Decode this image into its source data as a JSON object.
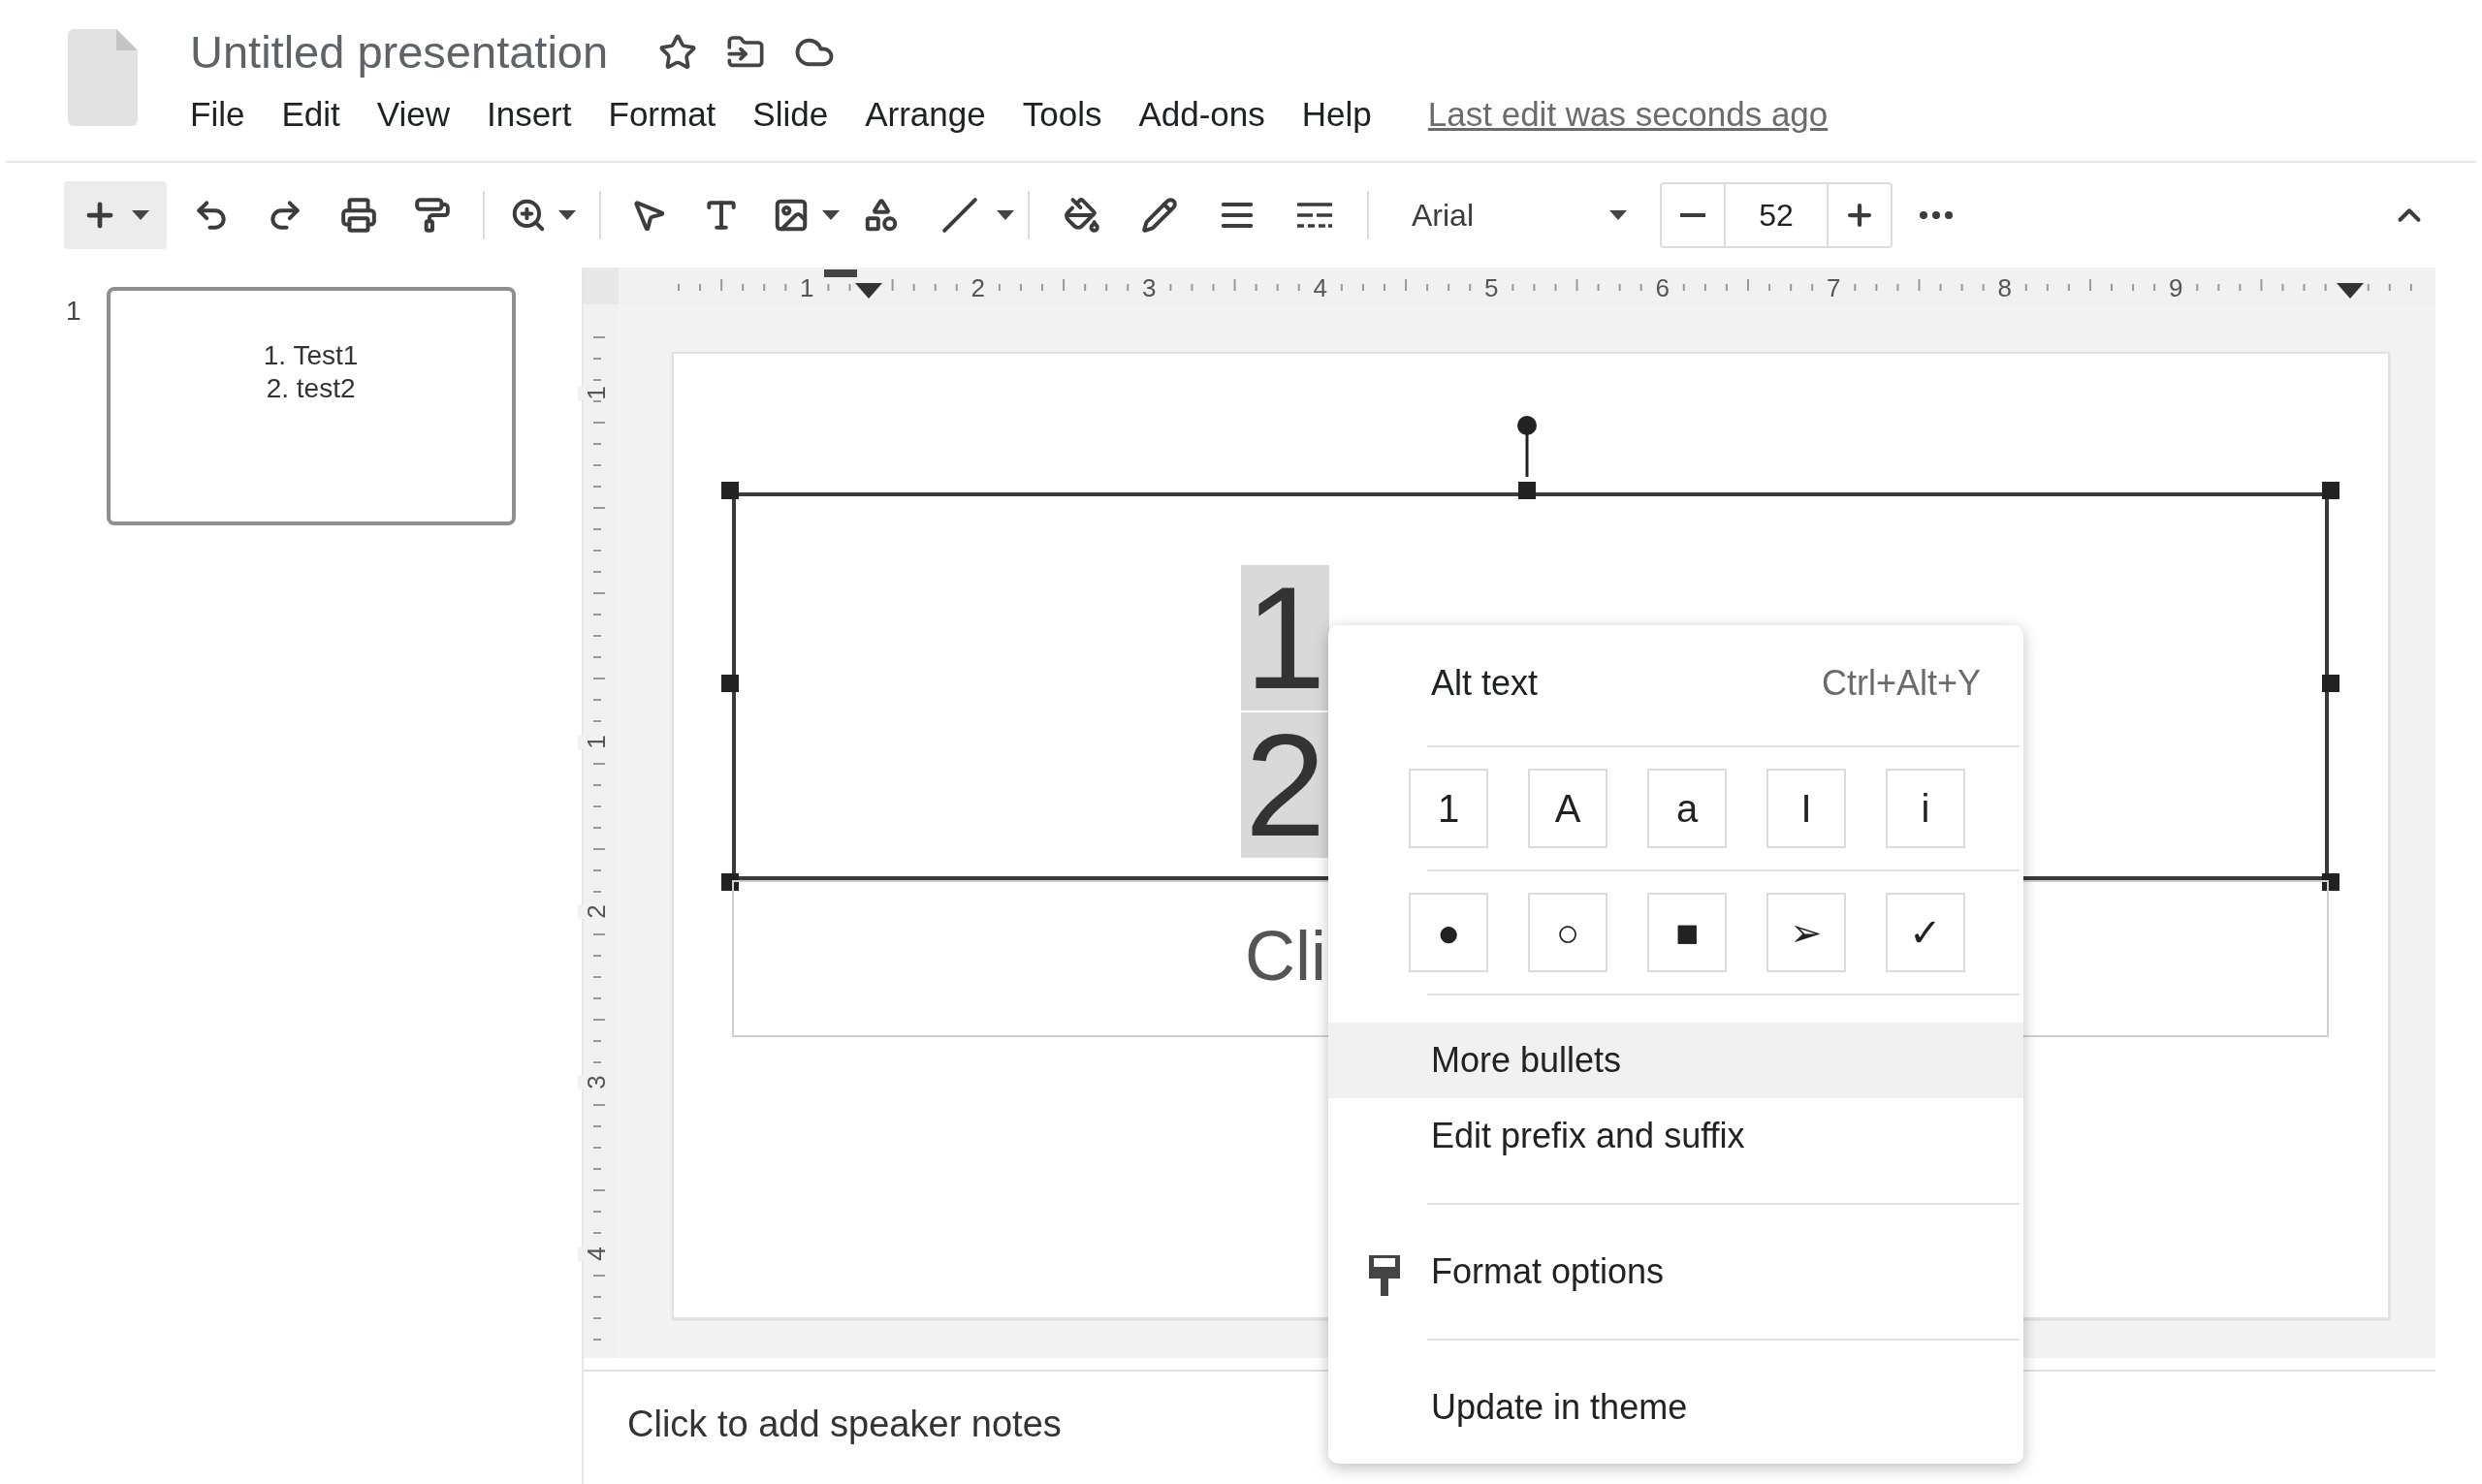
{
  "document": {
    "title": "Untitled presentation",
    "last_edit": "Last edit was seconds ago"
  },
  "menu_bar": [
    "File",
    "Edit",
    "View",
    "Insert",
    "Format",
    "Slide",
    "Arrange",
    "Tools",
    "Add-ons",
    "Help"
  ],
  "toolbar": {
    "font": "Arial",
    "font_size": "52"
  },
  "filmstrip": [
    {
      "number": "1",
      "selected": true,
      "lines": [
        "1. Test1",
        "2. test2"
      ]
    }
  ],
  "ruler": {
    "horizontal": [
      "1",
      "2",
      "3",
      "4",
      "5",
      "6",
      "7",
      "8",
      "9"
    ],
    "vertical": [
      "1",
      "1",
      "2",
      "3",
      "4"
    ]
  },
  "slide": {
    "list": [
      {
        "number": "1"
      },
      {
        "number": "2"
      }
    ],
    "subtitle": "Cli"
  },
  "context_menu": {
    "alt_text": {
      "label": "Alt text",
      "shortcut": "Ctrl+Alt+Y"
    },
    "numbered": [
      "1",
      "A",
      "a",
      "I",
      "i"
    ],
    "bullets": [
      "●",
      "○",
      "■",
      "➢",
      "✓"
    ],
    "items": [
      {
        "kind": "item",
        "label": "More bullets",
        "selected": true
      },
      {
        "kind": "item",
        "label": "Edit prefix and suffix",
        "selected": false
      },
      {
        "kind": "separator"
      },
      {
        "kind": "icon_item",
        "label": "Format options",
        "selected": false
      },
      {
        "kind": "separator"
      },
      {
        "kind": "item",
        "label": "Update in theme",
        "selected": false
      }
    ]
  },
  "speaker_notes": {
    "placeholder": "Click to add speaker notes"
  }
}
